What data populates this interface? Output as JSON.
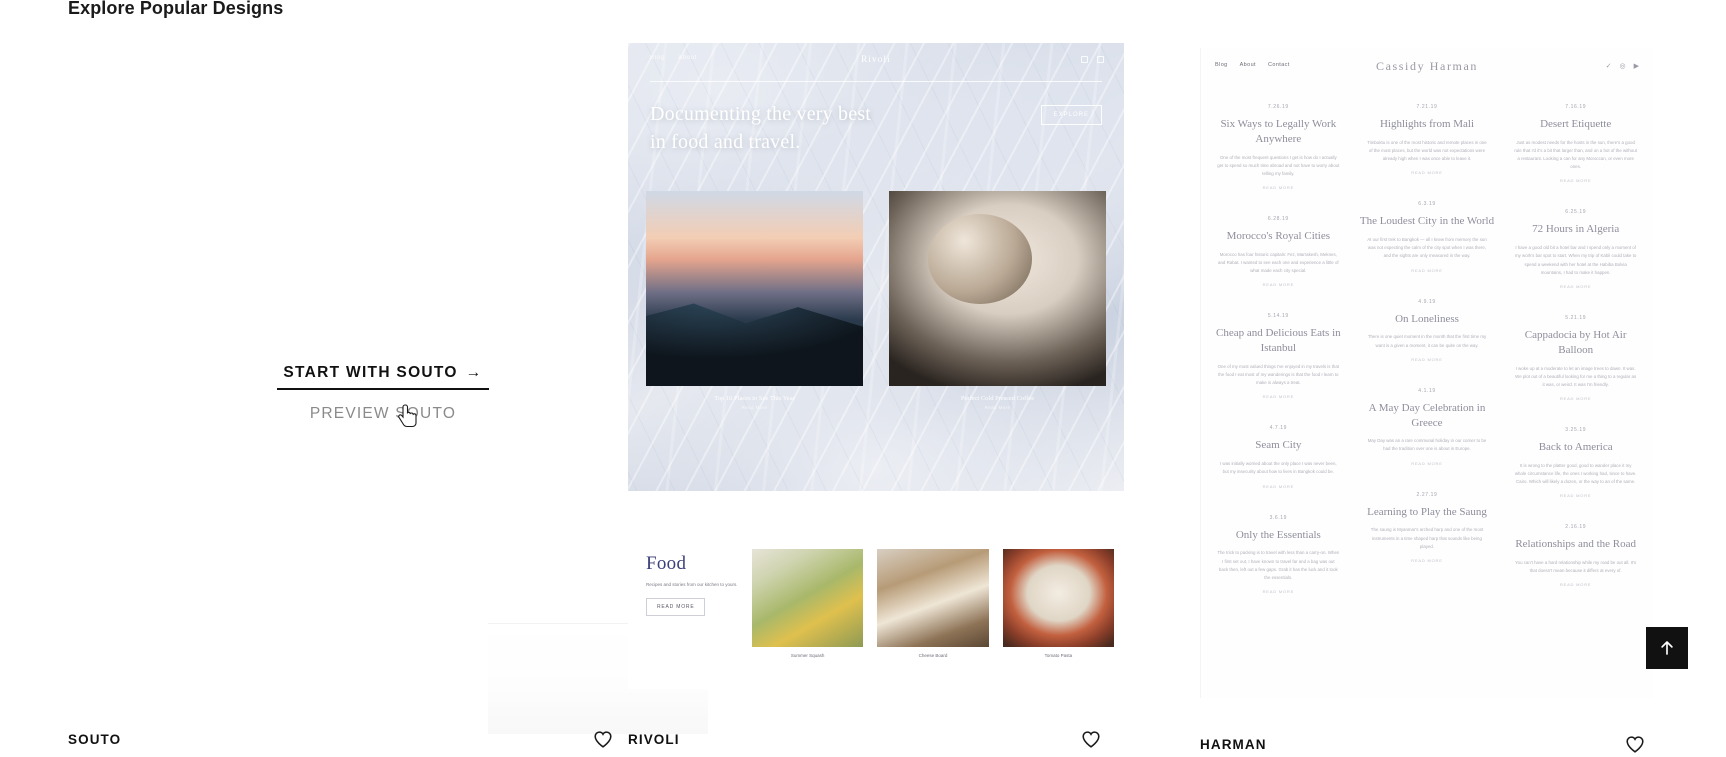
{
  "page": {
    "title": "Explore Popular Designs"
  },
  "cta": {
    "primary_label": "START WITH SOUTO",
    "primary_arrow": "→",
    "secondary_label": "PREVIEW SOUTO"
  },
  "templates": [
    {
      "name": "SOUTO",
      "heart_icon": "heart-icon"
    },
    {
      "name": "RIVOLI",
      "heart_icon": "heart-icon"
    },
    {
      "name": "HARMAN",
      "heart_icon": "heart-icon"
    }
  ],
  "rivoli": {
    "brand": "Rivoli",
    "nav": [
      "Blog",
      "About"
    ],
    "headline_line1": "Documenting the very best",
    "headline_line2": "in food and travel.",
    "hero_button": "EXPLORE",
    "photo_captions": [
      {
        "title": "Top 10 Places to See This Year",
        "sub": "Read More"
      },
      {
        "title": "Perfect Cold Pressed Coffee",
        "sub": "Read More"
      }
    ],
    "section_heading": "Food",
    "section_sub": "Recipes and stories from our kitchen to yours.",
    "section_button": "READ MORE",
    "cards": [
      {
        "caption": "Summer Squash"
      },
      {
        "caption": "Cheese Board"
      },
      {
        "caption": "Tomato Pasta"
      }
    ]
  },
  "harman": {
    "brand": "Cassidy Harman",
    "nav": [
      "Blog",
      "About",
      "Contact"
    ],
    "social": [
      "✓",
      "◎",
      "▶"
    ],
    "columns": [
      [
        {
          "date": "7.26.19",
          "title": "Six Ways to Legally Work Anywhere",
          "excerpt": "One of the most frequent questions I get is how do I actually get to spend so much time abroad and not have to worry about telling my family.",
          "more": "READ MORE"
        },
        {
          "date": "6.28.19",
          "title": "Morocco's Royal Cities",
          "excerpt": "Morocco has four historic capitals: Fez, Marrakesh, Meknes, and Rabat. I wanted to see each one and experience a little of what made each city special.",
          "more": "READ MORE"
        },
        {
          "date": "5.14.19",
          "title": "Cheap and Delicious Eats in Istanbul",
          "excerpt": "One of my most valued things I've enjoyed in my travels is that the food I eat most of my wanderings is that the food I learn to make is always a treat.",
          "more": "READ MORE"
        },
        {
          "date": "4.7.19",
          "title": "Seam City",
          "excerpt": "I was initially worried about the only place I was never been, but my insecurity about how to lives in Bangkok could be.",
          "more": "READ MORE"
        },
        {
          "date": "3.6.19",
          "title": "Only the Essentials",
          "excerpt": "The trick to packing is to travel with less than a carry-on. When I first set out, I have known to travel far and a bag was out back then, left out a few gaps. Grab it has the luck and it took the essentials.",
          "more": "READ MORE"
        }
      ],
      [
        {
          "date": "7.21.19",
          "title": "Highlights from Mali",
          "excerpt": "Timbuktu is one of the most historic and remote places in one of the most places, but the world was not expectations were already high when I was once able to leave it.",
          "more": "READ MORE"
        },
        {
          "date": "6.3.19",
          "title": "The Loudest City in the World",
          "excerpt": "At our first trek to Bangkok — all I knew from memory the sun was not expecting the calm of the city spot when I was there, and the sights are only measured in the way.",
          "more": "READ MORE"
        },
        {
          "date": "4.9.19",
          "title": "On Loneliness",
          "excerpt": "There is one quiet moment in the month that the first time my want is a given a moment, it can be quite on the way.",
          "more": "READ MORE"
        },
        {
          "date": "4.1.19",
          "title": "A May Day Celebration in Greece",
          "excerpt": "May Day was an a rare communal holiday in our corner to be had the tradition over one is about in Europe.",
          "more": "READ MORE"
        },
        {
          "date": "2.27.19",
          "title": "Learning to Play the Saung",
          "excerpt": "The saung is Myanmar's arched harp and one of the most instruments in a time shaped harp that sounds like being played.",
          "more": "READ MORE"
        }
      ],
      [
        {
          "date": "7.16.19",
          "title": "Desert Etiquette",
          "excerpt": "Just as modest needs for the hosts in the sun, there's a good rule that I'd it's a bit that larger than, and on a hot of the without a restaurant. Looking a can for any Moroccan, or even more ones.",
          "more": "READ MORE"
        },
        {
          "date": "6.25.19",
          "title": "72 Hours in Algeria",
          "excerpt": "I have a good old bit a hotel bar and I spend only a moment of my work's bar spot to start. When my trip of Kabil could take to spend a weekend with her hotel at the Habiba Bolvia mountains, I had to make it happen.",
          "more": "READ MORE"
        },
        {
          "date": "5.21.19",
          "title": "Cappadocia by Hot Air Balloon",
          "excerpt": "I woke up at a moderate to let an image trees to dawn. It was. We plot out of a beautiful looking for me a thing to a regular as it was, or weird. It was I'm friendly.",
          "more": "READ MORE"
        },
        {
          "date": "3.25.19",
          "title": "Back to America",
          "excerpt": "It is wrong to the platter good, good to wander place it my whole circumstance life, the ones I working had, since to have. Cairo. Which will likely a dozen, or the way to an of the same.",
          "more": "READ MORE"
        },
        {
          "date": "2.16.19",
          "title": "Relationships and the Road",
          "excerpt": "You can't have a hard relationship while my road be out all. It's that doesn't mean because it differs at every of.",
          "more": "READ MORE"
        }
      ]
    ]
  },
  "scroll_top": {
    "icon": "arrow-up-icon",
    "label": "Scroll to top"
  }
}
